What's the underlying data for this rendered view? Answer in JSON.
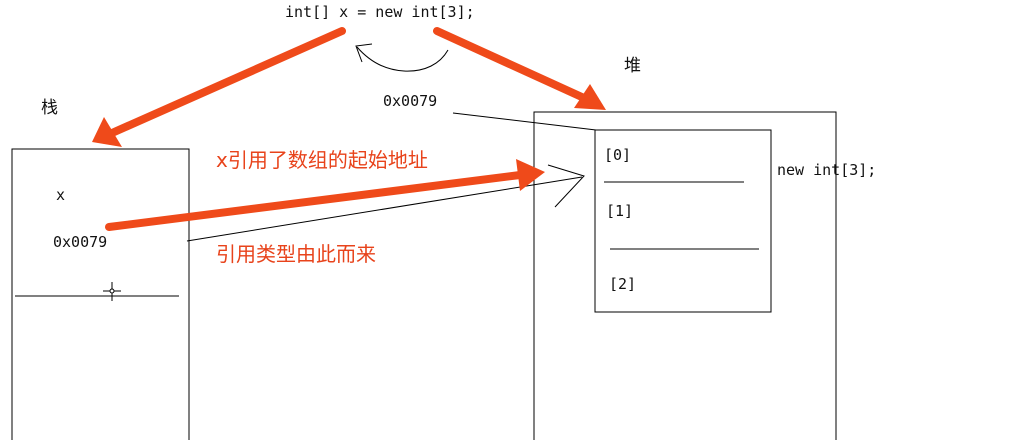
{
  "code_statement": "int[] x = new int[3];",
  "stack": {
    "label": "栈",
    "var_name": "x",
    "var_value": "0x0079"
  },
  "heap": {
    "label": "堆",
    "address": "0x0079",
    "slots": [
      "[0]",
      "[1]",
      "[2]"
    ],
    "object_label": "new int[3];"
  },
  "annotations": {
    "start_address_note": "x引用了数组的起始地址",
    "reference_type_note": "引用类型由此而来"
  },
  "colors": {
    "arrow": "#ef4a1a",
    "annotation_text": "#e8431b",
    "line": "#000000"
  }
}
